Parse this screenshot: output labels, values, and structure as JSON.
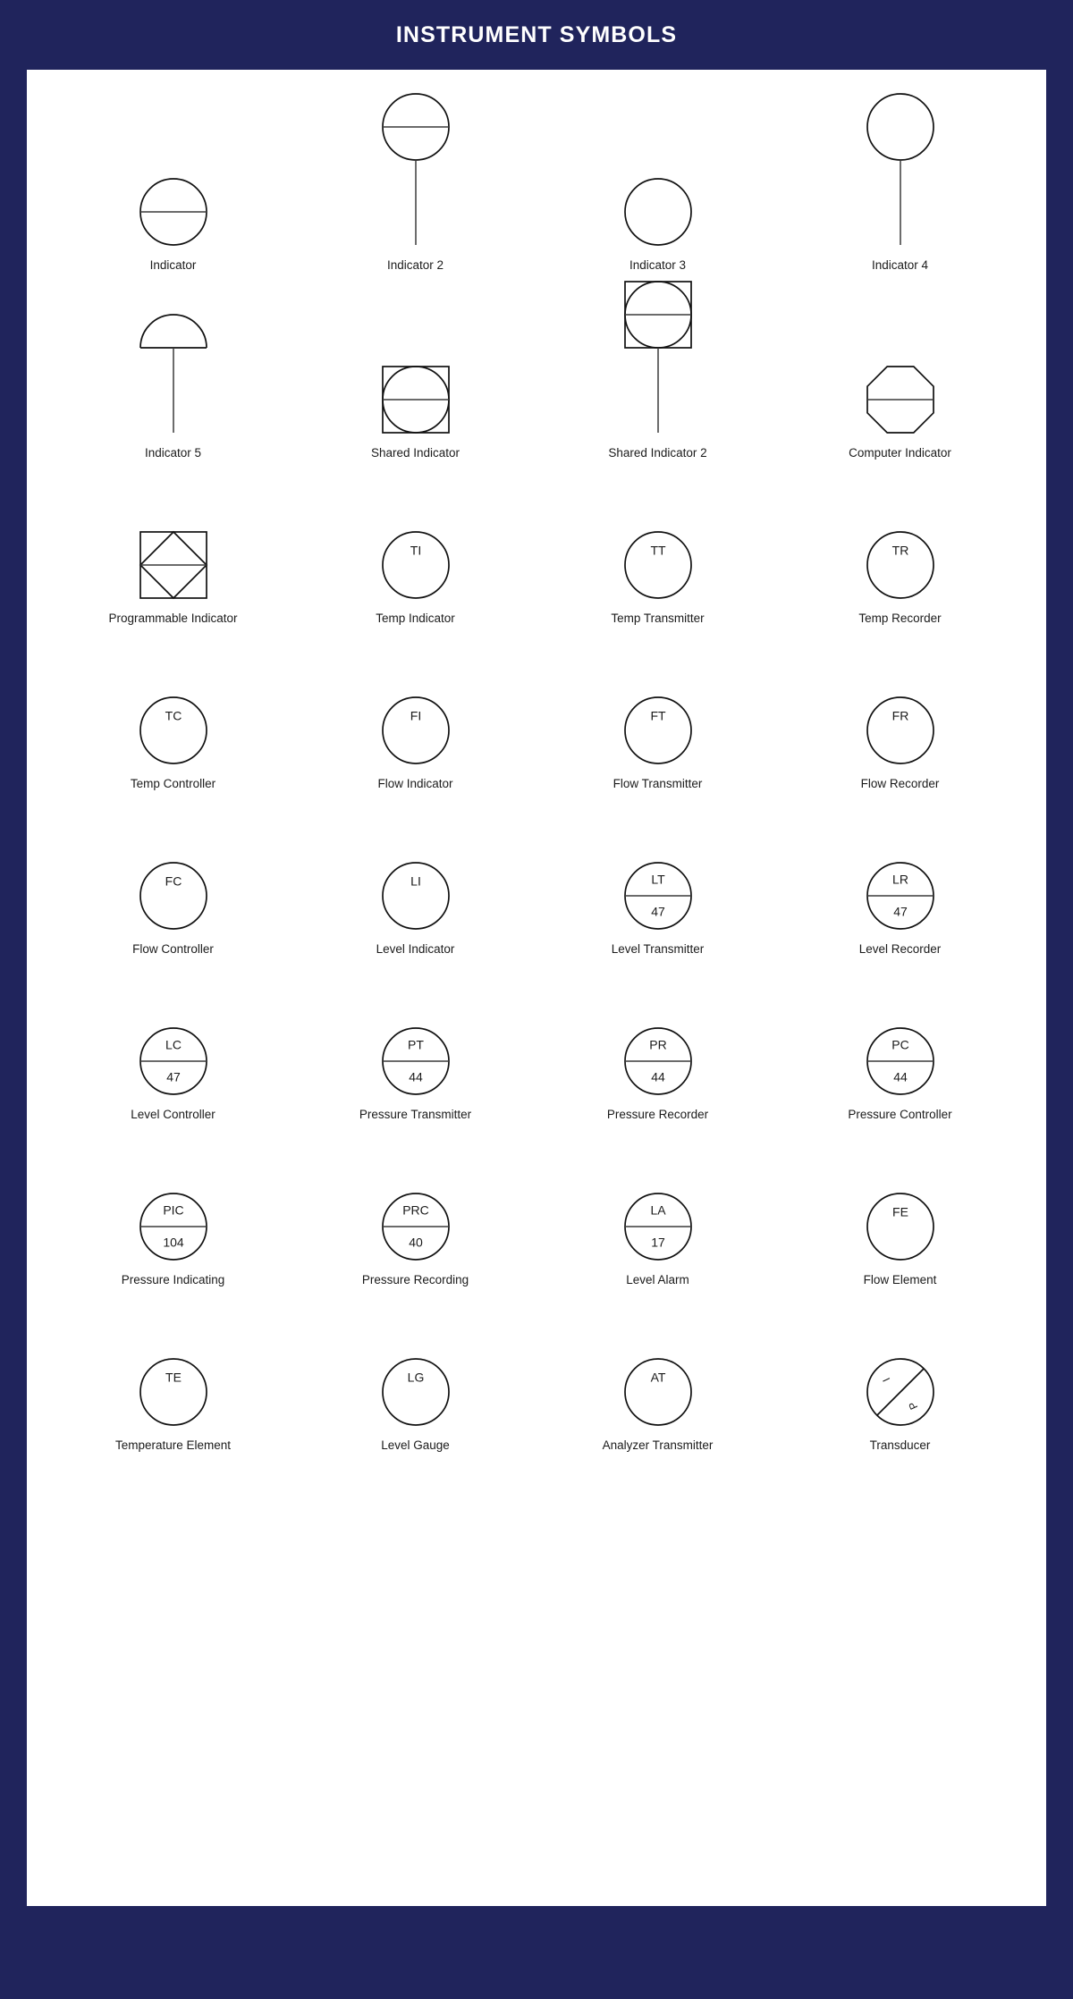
{
  "header": {
    "title": "INSTRUMENT SYMBOLS",
    "background_color": "#20245c",
    "title_color": "#ffffff"
  },
  "card": {
    "background_color": "#ffffff",
    "stroke_color": "#111111"
  },
  "rows": [
    {
      "row_index": 1,
      "cells": [
        {
          "label": "Indicator",
          "shape": "circle-hline",
          "tag": "",
          "number": ""
        },
        {
          "label": "Indicator 2",
          "shape": "circle-hline-stem",
          "tag": "",
          "number": ""
        },
        {
          "label": "Indicator 3",
          "shape": "circle",
          "tag": "",
          "number": ""
        },
        {
          "label": "Indicator 4",
          "shape": "circle-stem",
          "tag": "",
          "number": ""
        }
      ]
    },
    {
      "row_index": 2,
      "cells": [
        {
          "label": "Indicator 5",
          "shape": "semicircle-stem",
          "tag": "",
          "number": ""
        },
        {
          "label": "Shared Indicator",
          "shape": "square-circle-hline",
          "tag": "",
          "number": ""
        },
        {
          "label": "Shared Indicator 2",
          "shape": "square-circle-hline-stem",
          "tag": "",
          "number": ""
        },
        {
          "label": "Computer Indicator",
          "shape": "octagon-hline",
          "tag": "",
          "number": ""
        }
      ]
    },
    {
      "row_index": 3,
      "cells": [
        {
          "label": "Programmable Indicator",
          "shape": "square-diamond-hline",
          "tag": "",
          "number": ""
        },
        {
          "label": "Temp Indicator",
          "shape": "circle-tag",
          "tag": "TI",
          "number": ""
        },
        {
          "label": "Temp Transmitter",
          "shape": "circle-tag",
          "tag": "TT",
          "number": ""
        },
        {
          "label": "Temp Recorder",
          "shape": "circle-tag",
          "tag": "TR",
          "number": ""
        }
      ]
    },
    {
      "row_index": 4,
      "cells": [
        {
          "label": "Temp Controller",
          "shape": "circle-tag",
          "tag": "TC",
          "number": ""
        },
        {
          "label": "Flow Indicator",
          "shape": "circle-tag",
          "tag": "FI",
          "number": ""
        },
        {
          "label": "Flow Transmitter",
          "shape": "circle-tag",
          "tag": "FT",
          "number": ""
        },
        {
          "label": "Flow Recorder",
          "shape": "circle-tag",
          "tag": "FR",
          "number": ""
        }
      ]
    },
    {
      "row_index": 5,
      "cells": [
        {
          "label": "Flow Controller",
          "shape": "circle-tag",
          "tag": "FC",
          "number": ""
        },
        {
          "label": "Level Indicator",
          "shape": "circle-tag",
          "tag": "LI",
          "number": ""
        },
        {
          "label": "Level Transmitter",
          "shape": "circle-tag-num-hline",
          "tag": "LT",
          "number": "47"
        },
        {
          "label": "Level Recorder",
          "shape": "circle-tag-num-hline",
          "tag": "LR",
          "number": "47"
        }
      ]
    },
    {
      "row_index": 6,
      "cells": [
        {
          "label": "Level Controller",
          "shape": "circle-tag-num-hline",
          "tag": "LC",
          "number": "47"
        },
        {
          "label": "Pressure Transmitter",
          "shape": "circle-tag-num-hline",
          "tag": "PT",
          "number": "44"
        },
        {
          "label": "Pressure Recorder",
          "shape": "circle-tag-num-hline",
          "tag": "PR",
          "number": "44"
        },
        {
          "label": "Pressure Controller",
          "shape": "circle-tag-num-hline",
          "tag": "PC",
          "number": "44"
        }
      ]
    },
    {
      "row_index": 7,
      "cells": [
        {
          "label": "Pressure Indicating",
          "shape": "circle-tag-num-hline",
          "tag": "PIC",
          "number": "104"
        },
        {
          "label": "Pressure Recording",
          "shape": "circle-tag-num-hline",
          "tag": "PRC",
          "number": "40"
        },
        {
          "label": "Level Alarm",
          "shape": "circle-tag-num-hline",
          "tag": "LA",
          "number": "17"
        },
        {
          "label": "Flow Element",
          "shape": "circle-tag",
          "tag": "FE",
          "number": ""
        }
      ]
    },
    {
      "row_index": 8,
      "cells": [
        {
          "label": "Temperature Element",
          "shape": "circle-tag",
          "tag": "TE",
          "number": ""
        },
        {
          "label": "Level Gauge",
          "shape": "circle-tag",
          "tag": "LG",
          "number": ""
        },
        {
          "label": "Analyzer Transmitter",
          "shape": "circle-tag",
          "tag": "AT",
          "number": ""
        },
        {
          "label": "Transducer",
          "shape": "circle-diagonal-ip",
          "tag": "I",
          "number": "P"
        }
      ]
    }
  ]
}
